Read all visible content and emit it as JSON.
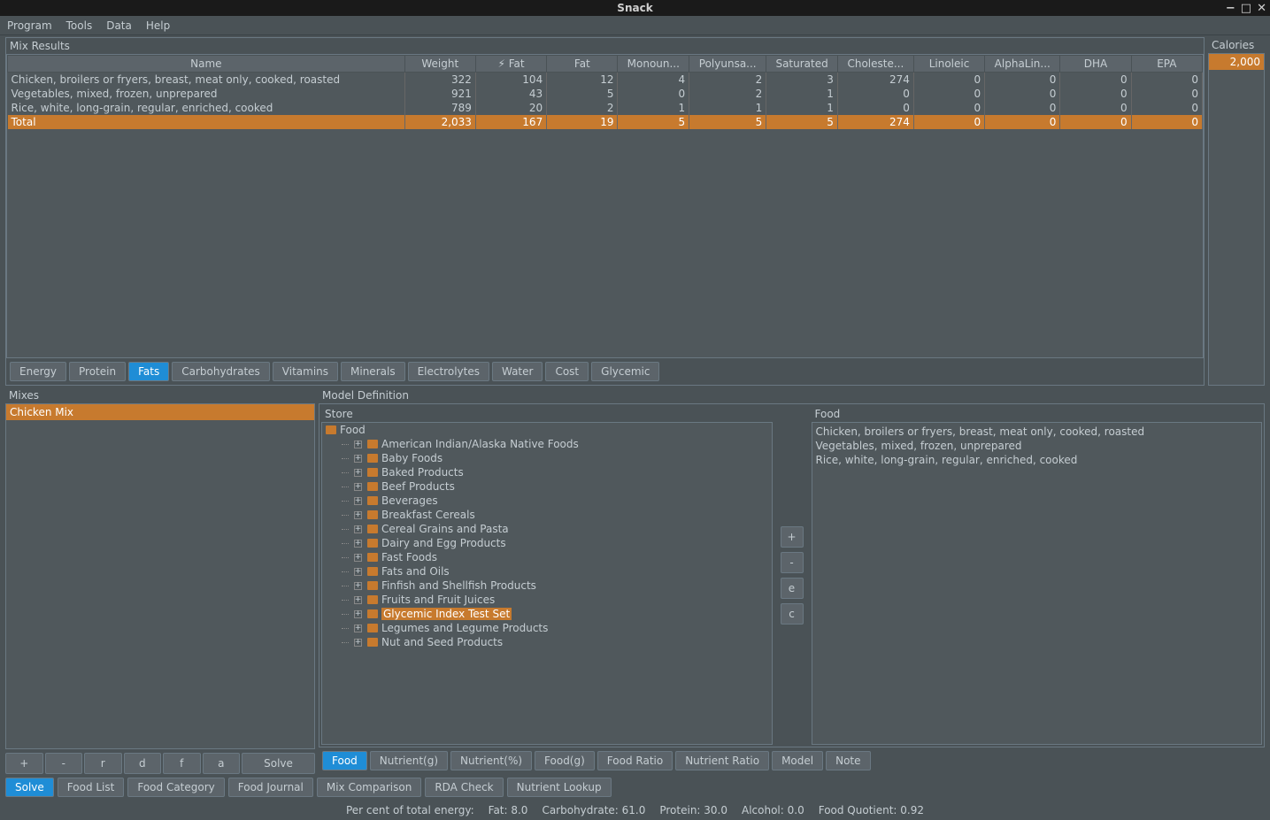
{
  "window": {
    "title": "Snack"
  },
  "menubar": [
    "Program",
    "Tools",
    "Data",
    "Help"
  ],
  "mix_results": {
    "label": "Mix Results",
    "columns": [
      "Name",
      "Weight",
      "⚡ Fat",
      "Fat",
      "Monoun...",
      "Polyunsa...",
      "Saturated",
      "Choleste...",
      "Linoleic",
      "AlphaLin...",
      "DHA",
      "EPA"
    ],
    "rows": [
      {
        "name": "Chicken, broilers or fryers, breast, meat only, cooked, roasted",
        "vals": [
          "322",
          "104",
          "12",
          "4",
          "2",
          "3",
          "274",
          "0",
          "0",
          "0",
          "0"
        ]
      },
      {
        "name": "Vegetables, mixed, frozen, unprepared",
        "vals": [
          "921",
          "43",
          "5",
          "0",
          "2",
          "1",
          "0",
          "0",
          "0",
          "0",
          "0"
        ]
      },
      {
        "name": "Rice, white, long-grain, regular, enriched, cooked",
        "vals": [
          "789",
          "20",
          "2",
          "1",
          "1",
          "1",
          "0",
          "0",
          "0",
          "0",
          "0"
        ]
      }
    ],
    "total": {
      "name": "Total",
      "vals": [
        "2,033",
        "167",
        "19",
        "5",
        "5",
        "5",
        "274",
        "0",
        "0",
        "0",
        "0"
      ]
    }
  },
  "result_tabs": [
    "Energy",
    "Protein",
    "Fats",
    "Carbohydrates",
    "Vitamins",
    "Minerals",
    "Electrolytes",
    "Water",
    "Cost",
    "Glycemic"
  ],
  "result_tab_active": 2,
  "calories": {
    "label": "Calories",
    "value": "2,000"
  },
  "mixes": {
    "label": "Mixes",
    "items": [
      "Chicken Mix"
    ],
    "selected": 0,
    "buttons": [
      "+",
      "-",
      "r",
      "d",
      "f",
      "a",
      "Solve"
    ]
  },
  "model": {
    "label": "Model Definition",
    "store_label": "Store",
    "food_label": "Food",
    "tree_root": "Food",
    "tree_children": [
      "American Indian/Alaska Native Foods",
      "Baby Foods",
      "Baked Products",
      "Beef Products",
      "Beverages",
      "Breakfast Cereals",
      "Cereal Grains and Pasta",
      "Dairy and Egg Products",
      "Fast Foods",
      "Fats and Oils",
      "Finfish and Shellfish Products",
      "Fruits and Fruit Juices",
      "Glycemic Index Test Set",
      "Legumes and Legume Products",
      "Nut and Seed Products"
    ],
    "tree_selected": 12,
    "mid_buttons": [
      "+",
      "-",
      "e",
      "c"
    ],
    "food_items": [
      "Chicken, broilers or fryers, breast, meat only, cooked, roasted",
      "Vegetables, mixed, frozen, unprepared",
      "Rice, white, long-grain, regular, enriched, cooked"
    ],
    "bottom_tabs": [
      "Food",
      "Nutrient(g)",
      "Nutrient(%)",
      "Food(g)",
      "Food Ratio",
      "Nutrient Ratio",
      "Model",
      "Note"
    ],
    "bottom_tab_active": 0
  },
  "main_tabs": [
    "Solve",
    "Food List",
    "Food Category",
    "Food Journal",
    "Mix Comparison",
    "RDA Check",
    "Nutrient Lookup"
  ],
  "main_tab_active": 0,
  "status": {
    "label": "Per cent of total energy:",
    "items": [
      "Fat: 8.0",
      "Carbohydrate: 61.0",
      "Protein: 30.0",
      "Alcohol: 0.0",
      "Food Quotient: 0.92"
    ]
  }
}
